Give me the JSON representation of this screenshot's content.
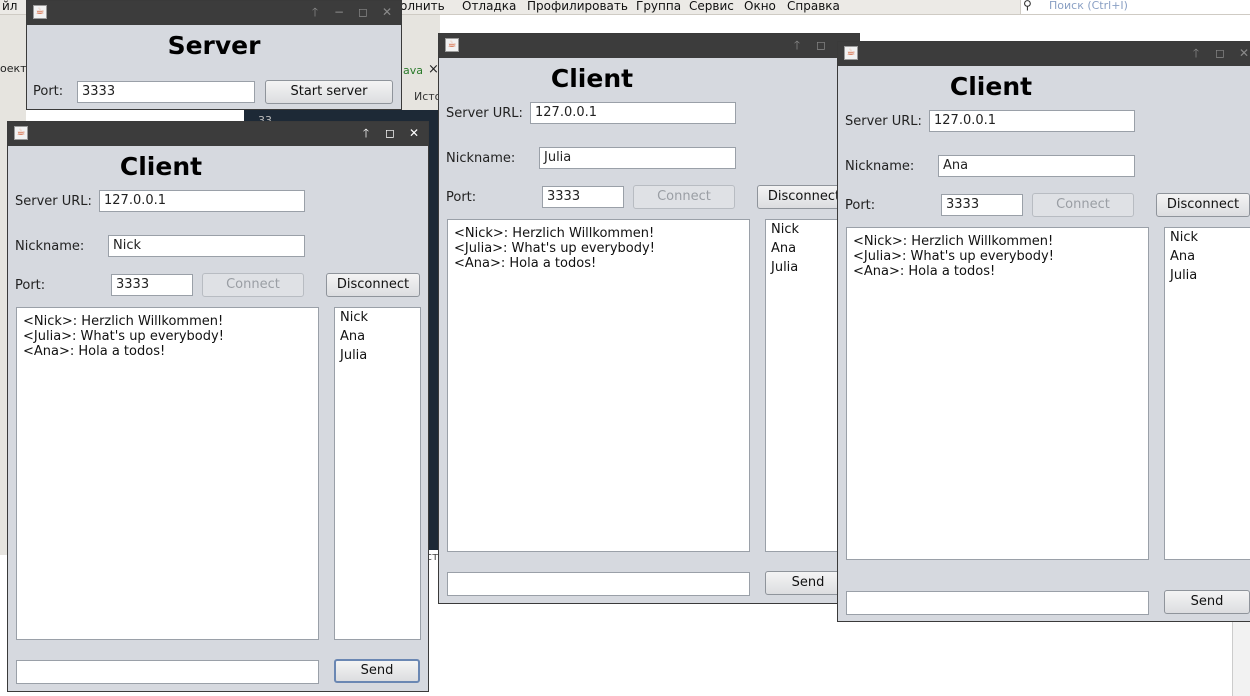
{
  "ide": {
    "menu": [
      "йл",
      "олнить",
      "Отладка",
      "Профилировать",
      "Группа",
      "Сервис",
      "Окно",
      "Справка"
    ],
    "search_placeholder": "Поиск (Ctrl+I)",
    "fragments": {
      "oekt": "оект",
      "ava": "ava",
      "ist": "Исто",
      "num": "33",
      "stl": "стл"
    }
  },
  "server": {
    "heading": "Server",
    "port_label": "Port:",
    "port_value": "3333",
    "start_label": "Start server"
  },
  "clients": [
    {
      "heading": "Client",
      "url_label": "Server URL:",
      "url_value": "127.0.0.1",
      "nick_label": "Nickname:",
      "nick_value": "Nick",
      "port_label": "Port:",
      "port_value": "3333",
      "connect_label": "Connect",
      "disconnect_label": "Disconnect",
      "messages": [
        "<Nick>: Herzlich Willkommen!",
        "<Julia>: What's up everybody!",
        "<Ana>: Hola a todos!"
      ],
      "users": [
        "Nick",
        "Ana",
        "Julia"
      ],
      "input_value": "",
      "send_label": "Send"
    },
    {
      "heading": "Client",
      "url_label": "Server URL:",
      "url_value": "127.0.0.1",
      "nick_label": "Nickname:",
      "nick_value": "Julia",
      "port_label": "Port:",
      "port_value": "3333",
      "connect_label": "Connect",
      "disconnect_label": "Disconnect",
      "messages": [
        "<Nick>: Herzlich Willkommen!",
        "<Julia>: What's up everybody!",
        "<Ana>: Hola a todos!"
      ],
      "users": [
        "Nick",
        "Ana",
        "Julia"
      ],
      "input_value": "",
      "send_label": "Send"
    },
    {
      "heading": "Client",
      "url_label": "Server URL:",
      "url_value": "127.0.0.1",
      "nick_label": "Nickname:",
      "nick_value": "Ana",
      "port_label": "Port:",
      "port_value": "3333",
      "connect_label": "Connect",
      "disconnect_label": "Disconnect",
      "messages": [
        "<Nick>: Herzlich Willkommen!",
        "<Julia>: What's up everybody!",
        "<Ana>: Hola a todos!"
      ],
      "users": [
        "Nick",
        "Ana",
        "Julia"
      ],
      "input_value": "",
      "send_label": "Send"
    }
  ],
  "titlebar_icons": [
    "java-icon",
    "pin-icon",
    "minimize-icon",
    "maximize-icon",
    "close-icon"
  ]
}
